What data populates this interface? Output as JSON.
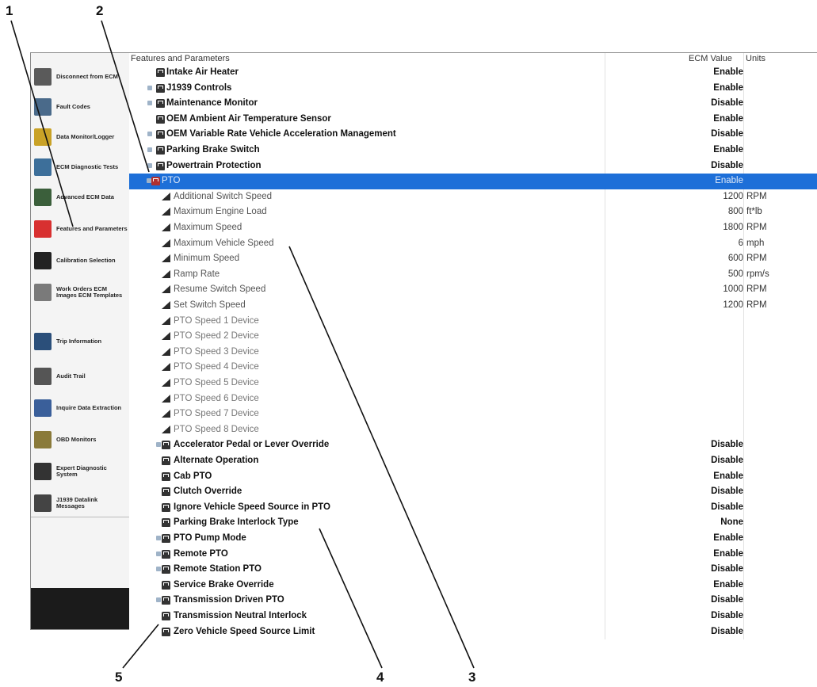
{
  "callouts": [
    "1",
    "2",
    "3",
    "4",
    "5"
  ],
  "sidebar": {
    "items": [
      {
        "label": "Disconnect from ECM",
        "icon": "disconnect-icon",
        "color": "#5a5a5a"
      },
      {
        "label": "Fault Codes",
        "icon": "fault-codes-icon",
        "color": "#4a6a8a"
      },
      {
        "label": "Data Monitor/Logger",
        "icon": "data-monitor-icon",
        "color": "#c9a227"
      },
      {
        "label": "ECM Diagnostic Tests",
        "icon": "diagnostic-tests-icon",
        "color": "#3d6f9a"
      },
      {
        "label": "Advanced ECM Data",
        "icon": "advanced-data-icon",
        "color": "#3b5f3b"
      },
      {
        "label": "Features and Parameters",
        "icon": "features-parameters-icon",
        "color": "#d83030"
      },
      {
        "label": "Calibration Selection",
        "icon": "calibration-icon",
        "color": "#222222"
      },
      {
        "label": "Work Orders ECM Images ECM Templates",
        "icon": "work-orders-icon",
        "color": "#7a7a7a"
      },
      {
        "label": "Trip Information",
        "icon": "trip-info-icon",
        "color": "#2b4f7a"
      },
      {
        "label": "Audit Trail",
        "icon": "audit-trail-icon",
        "color": "#555555"
      },
      {
        "label": "Inquire Data Extraction",
        "icon": "data-extraction-icon",
        "color": "#3a5f9a"
      },
      {
        "label": "OBD Monitors",
        "icon": "obd-monitors-icon",
        "color": "#8a7a3a"
      },
      {
        "label": "Expert Diagnostic System",
        "icon": "expert-diagnostic-icon",
        "color": "#333333"
      },
      {
        "label": "J1939 Datalink Messages",
        "icon": "datalink-icon",
        "color": "#444444"
      }
    ]
  },
  "table": {
    "columns": {
      "name": "Features and Parameters",
      "value": "ECM Value",
      "units": "Units"
    },
    "rows": [
      {
        "name": "Intake Air Heater",
        "value": "Enable",
        "units": "",
        "kind": "group",
        "exp": false
      },
      {
        "name": "J1939 Controls",
        "value": "Enable",
        "units": "",
        "kind": "group",
        "exp": true
      },
      {
        "name": "Maintenance Monitor",
        "value": "Disable",
        "units": "",
        "kind": "group",
        "exp": true
      },
      {
        "name": "OEM Ambient Air Temperature Sensor",
        "value": "Enable",
        "units": "",
        "kind": "group",
        "exp": false
      },
      {
        "name": "OEM Variable Rate Vehicle Acceleration Management",
        "value": "Disable",
        "units": "",
        "kind": "group",
        "exp": true
      },
      {
        "name": "Parking Brake Switch",
        "value": "Enable",
        "units": "",
        "kind": "group",
        "exp": true
      },
      {
        "name": "Powertrain Protection",
        "value": "Disable",
        "units": "",
        "kind": "group",
        "exp": true
      },
      {
        "name": "PTO",
        "value": "Enable",
        "units": "",
        "kind": "selected",
        "exp": true
      },
      {
        "name": "Additional Switch Speed",
        "value": "1200",
        "units": "RPM",
        "kind": "param"
      },
      {
        "name": "Maximum Engine Load",
        "value": "800",
        "units": "ft*lb",
        "kind": "param"
      },
      {
        "name": "Maximum Speed",
        "value": "1800",
        "units": "RPM",
        "kind": "param"
      },
      {
        "name": "Maximum Vehicle Speed",
        "value": "6",
        "units": "mph",
        "kind": "param"
      },
      {
        "name": "Minimum Speed",
        "value": "600",
        "units": "RPM",
        "kind": "param"
      },
      {
        "name": "Ramp Rate",
        "value": "500",
        "units": "rpm/s",
        "kind": "param"
      },
      {
        "name": "Resume Switch Speed",
        "value": "1000",
        "units": "RPM",
        "kind": "param"
      },
      {
        "name": "Set Switch Speed",
        "value": "1200",
        "units": "RPM",
        "kind": "param"
      },
      {
        "name": "PTO Speed 1 Device",
        "value": "",
        "units": "",
        "kind": "param"
      },
      {
        "name": "PTO Speed 2 Device",
        "value": "",
        "units": "",
        "kind": "param"
      },
      {
        "name": "PTO Speed 3 Device",
        "value": "",
        "units": "",
        "kind": "param"
      },
      {
        "name": "PTO Speed 4 Device",
        "value": "",
        "units": "",
        "kind": "param"
      },
      {
        "name": "PTO Speed 5 Device",
        "value": "",
        "units": "",
        "kind": "param"
      },
      {
        "name": "PTO Speed 6 Device",
        "value": "",
        "units": "",
        "kind": "param"
      },
      {
        "name": "PTO Speed 7 Device",
        "value": "",
        "units": "",
        "kind": "param"
      },
      {
        "name": "PTO Speed 8 Device",
        "value": "",
        "units": "",
        "kind": "param"
      },
      {
        "name": "Accelerator Pedal or Lever Override",
        "value": "Disable",
        "units": "",
        "kind": "sub",
        "exp": true
      },
      {
        "name": "Alternate Operation",
        "value": "Disable",
        "units": "",
        "kind": "sub",
        "exp": false
      },
      {
        "name": "Cab PTO",
        "value": "Enable",
        "units": "",
        "kind": "sub",
        "exp": false
      },
      {
        "name": "Clutch Override",
        "value": "Disable",
        "units": "",
        "kind": "sub",
        "exp": false
      },
      {
        "name": "Ignore Vehicle Speed Source in PTO",
        "value": "Disable",
        "units": "",
        "kind": "sub",
        "exp": false
      },
      {
        "name": "Parking Brake Interlock Type",
        "value": "None",
        "units": "",
        "kind": "sub",
        "exp": false
      },
      {
        "name": "PTO Pump Mode",
        "value": "Enable",
        "units": "",
        "kind": "sub",
        "exp": true
      },
      {
        "name": "Remote PTO",
        "value": "Enable",
        "units": "",
        "kind": "sub",
        "exp": true
      },
      {
        "name": "Remote Station PTO",
        "value": "Disable",
        "units": "",
        "kind": "sub",
        "exp": true
      },
      {
        "name": "Service Brake Override",
        "value": "Enable",
        "units": "",
        "kind": "sub",
        "exp": false
      },
      {
        "name": "Transmission Driven PTO",
        "value": "Disable",
        "units": "",
        "kind": "sub",
        "exp": true
      },
      {
        "name": "Transmission Neutral Interlock",
        "value": "Disable",
        "units": "",
        "kind": "sub",
        "exp": false
      },
      {
        "name": "Zero Vehicle Speed Source Limit",
        "value": "Disable",
        "units": "",
        "kind": "sub",
        "exp": false
      }
    ]
  },
  "colors": {
    "selection": "#1d6fd8",
    "sidebar_bg": "#f4f4f4"
  }
}
